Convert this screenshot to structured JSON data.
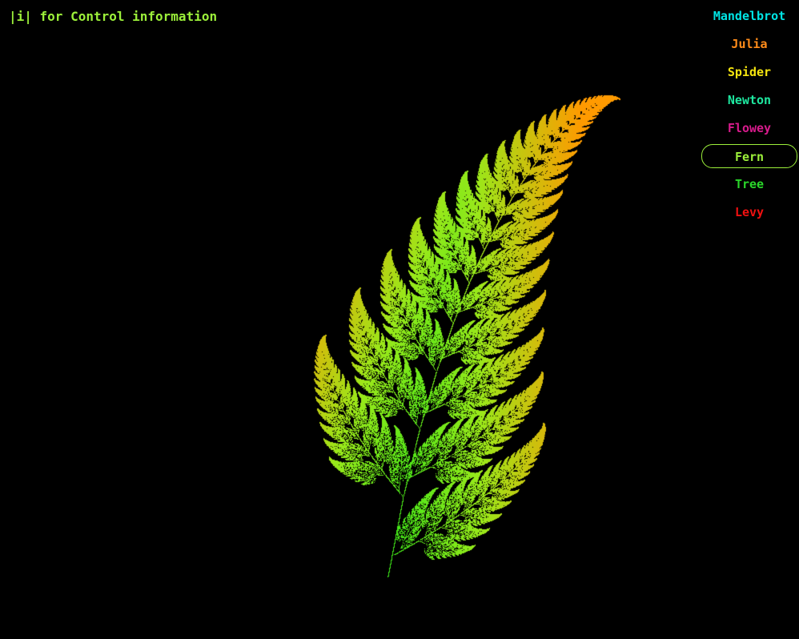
{
  "app": {
    "hint_text": "|i| for Control information",
    "hint_color": "#9cf03a",
    "background": "#000000"
  },
  "menu": {
    "selected": "Fern",
    "items": [
      {
        "label": "Mandelbrot",
        "color": "#00e5e5"
      },
      {
        "label": "Julia",
        "color": "#ff8c1a"
      },
      {
        "label": "Spider",
        "color": "#f5e50f"
      },
      {
        "label": "Newton",
        "color": "#1ee8a0"
      },
      {
        "label": "Flowey",
        "color": "#d81b8c"
      },
      {
        "label": "Fern",
        "color": "#9cf03a"
      },
      {
        "label": "Tree",
        "color": "#2ad62a"
      },
      {
        "label": "Levy",
        "color": "#f01010"
      }
    ]
  },
  "fern": {
    "type": "barnsley-fern",
    "colors": {
      "base": "#17e617",
      "tip": "#ff9a00",
      "mid": "#9ae81a"
    }
  }
}
